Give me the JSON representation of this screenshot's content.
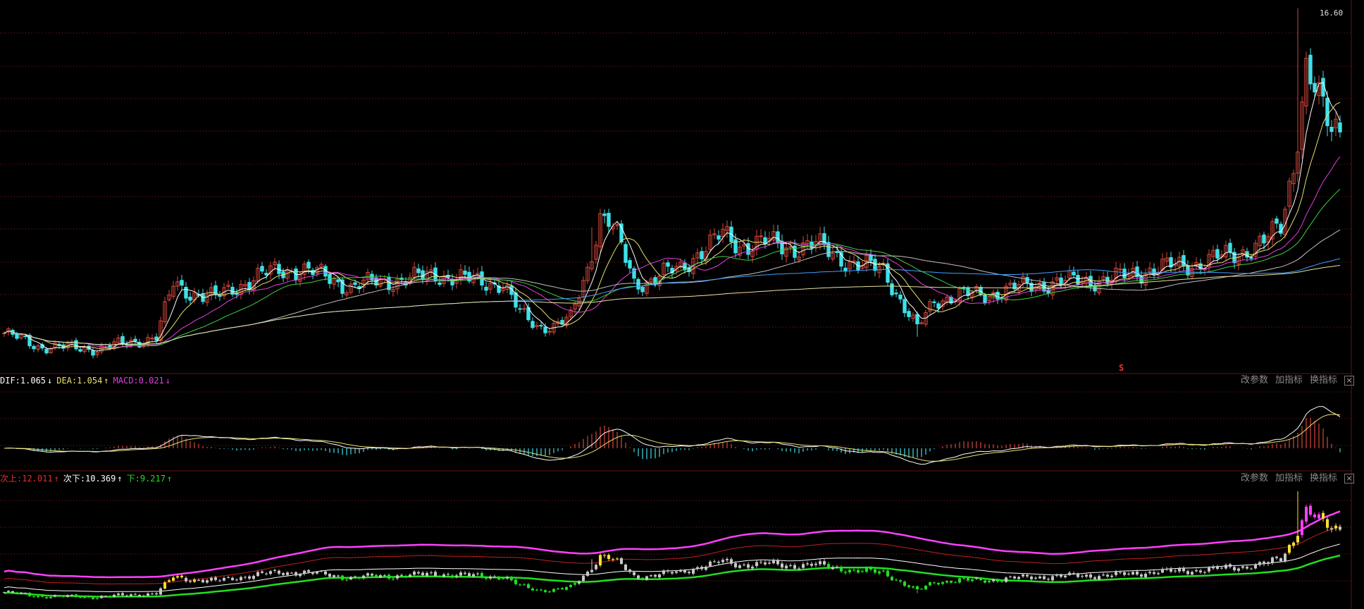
{
  "colors": {
    "up": "#d6473a",
    "down": "#3ee0e8",
    "grid": "#8a1a1a",
    "ma5": "#ffffff",
    "ma10": "#e8e070",
    "ma20": "#e040e0",
    "ma30": "#40d040",
    "ma60": "#c0c0c0",
    "ma120": "#40a0ff",
    "ma250": "#e8e0a0",
    "band_top": "#ff40ff",
    "band_mid": "#c02020",
    "band_low": "#ffffff",
    "band_bottom": "#20e020"
  },
  "price_panel": {
    "high_marker": "16.60",
    "event_marker": "S"
  },
  "macd_panel": {
    "dif_label": "DIF:1.065",
    "dif_arrow": "↓",
    "dea_label": "DEA:1.054",
    "dea_arrow": "↑",
    "macd_label": "MACD:0.021",
    "macd_arrow": "↓",
    "buttons": [
      "改参数",
      "加指标",
      "换指标"
    ],
    "close": "×"
  },
  "band_panel": {
    "label1": "次上:12.011",
    "arrow1": "↑",
    "label2": "次下:10.369",
    "arrow2": "↑",
    "label3": "下:9.217",
    "arrow3": "↑",
    "buttons": [
      "改参数",
      "加指标",
      "换指标"
    ],
    "close": "×"
  },
  "chart_data": {
    "type": "candlestick",
    "title": "",
    "ylim": [
      3.6,
      17.0
    ],
    "keyframes_close": [
      [
        0,
        4.55
      ],
      [
        8,
        4.05
      ],
      [
        22,
        3.95
      ],
      [
        30,
        4.2
      ],
      [
        36,
        4.4
      ],
      [
        40,
        6.4
      ],
      [
        44,
        6.1
      ],
      [
        50,
        5.9
      ],
      [
        56,
        6.4
      ],
      [
        60,
        6.7
      ],
      [
        64,
        6.9
      ],
      [
        70,
        7.0
      ],
      [
        76,
        6.7
      ],
      [
        82,
        6.3
      ],
      [
        88,
        6.5
      ],
      [
        96,
        6.6
      ],
      [
        102,
        6.8
      ],
      [
        108,
        6.6
      ],
      [
        114,
        6.5
      ],
      [
        118,
        6.4
      ],
      [
        122,
        5.3
      ],
      [
        126,
        4.85
      ],
      [
        130,
        4.8
      ],
      [
        134,
        5.1
      ],
      [
        138,
        7.0
      ],
      [
        141,
        9.0
      ],
      [
        143,
        8.8
      ],
      [
        146,
        7.8
      ],
      [
        149,
        6.5
      ],
      [
        152,
        6.5
      ],
      [
        156,
        6.8
      ],
      [
        160,
        7.0
      ],
      [
        164,
        7.6
      ],
      [
        167,
        7.9
      ],
      [
        170,
        8.3
      ],
      [
        174,
        7.9
      ],
      [
        180,
        8.0
      ],
      [
        186,
        7.8
      ],
      [
        192,
        7.9
      ],
      [
        197,
        7.5
      ],
      [
        202,
        7.1
      ],
      [
        208,
        7.0
      ],
      [
        213,
        5.5
      ],
      [
        216,
        4.7
      ],
      [
        220,
        5.8
      ],
      [
        226,
        6.0
      ],
      [
        232,
        6.0
      ],
      [
        240,
        6.3
      ],
      [
        250,
        6.5
      ],
      [
        262,
        6.6
      ],
      [
        272,
        7.0
      ],
      [
        282,
        7.2
      ],
      [
        292,
        7.6
      ],
      [
        298,
        8.0
      ],
      [
        302,
        8.6
      ],
      [
        305,
        11.0
      ],
      [
        308,
        14.6
      ],
      [
        311,
        13.3
      ],
      [
        314,
        12.3
      ],
      [
        316,
        12.5
      ]
    ]
  }
}
